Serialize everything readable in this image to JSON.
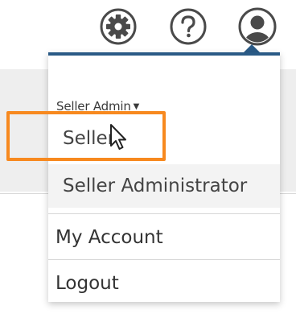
{
  "header": {
    "icons": [
      "gear-icon",
      "help-icon",
      "user-icon"
    ]
  },
  "dropdown": {
    "role_label": "Seller Admin",
    "role_options": [
      {
        "label": "Seller"
      },
      {
        "label": "Seller Administrator"
      }
    ],
    "links": [
      {
        "label": "My Account"
      },
      {
        "label": "Logout"
      }
    ]
  },
  "colors": {
    "accent": "#2a5a86",
    "highlight": "#f7891f",
    "icon_gray": "#4a4a4a"
  }
}
